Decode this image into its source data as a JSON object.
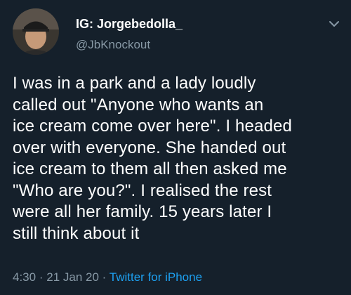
{
  "tweet": {
    "display_name": "IG: Jorgebedolla_",
    "handle": "@JbKnockout",
    "text_lines": [
      "I was in a park and a lady loudly",
      "called out \"Anyone who wants an",
      "ice cream come over here\". I headed",
      "over with everyone. She handed out",
      "ice cream to them all then asked me",
      "\"Who are you?\". I realised the rest",
      "were all her family. 15 years later I",
      "still think about it"
    ],
    "time": "4:30",
    "separator": "·",
    "date": "21 Jan 20",
    "source": "Twitter for iPhone"
  },
  "colors": {
    "background": "#15202b",
    "primary_text": "#ffffff",
    "secondary_text": "#8899a6",
    "link": "#1da1f2"
  },
  "icons": {
    "menu": "chevron-down-icon",
    "profile": "avatar"
  }
}
